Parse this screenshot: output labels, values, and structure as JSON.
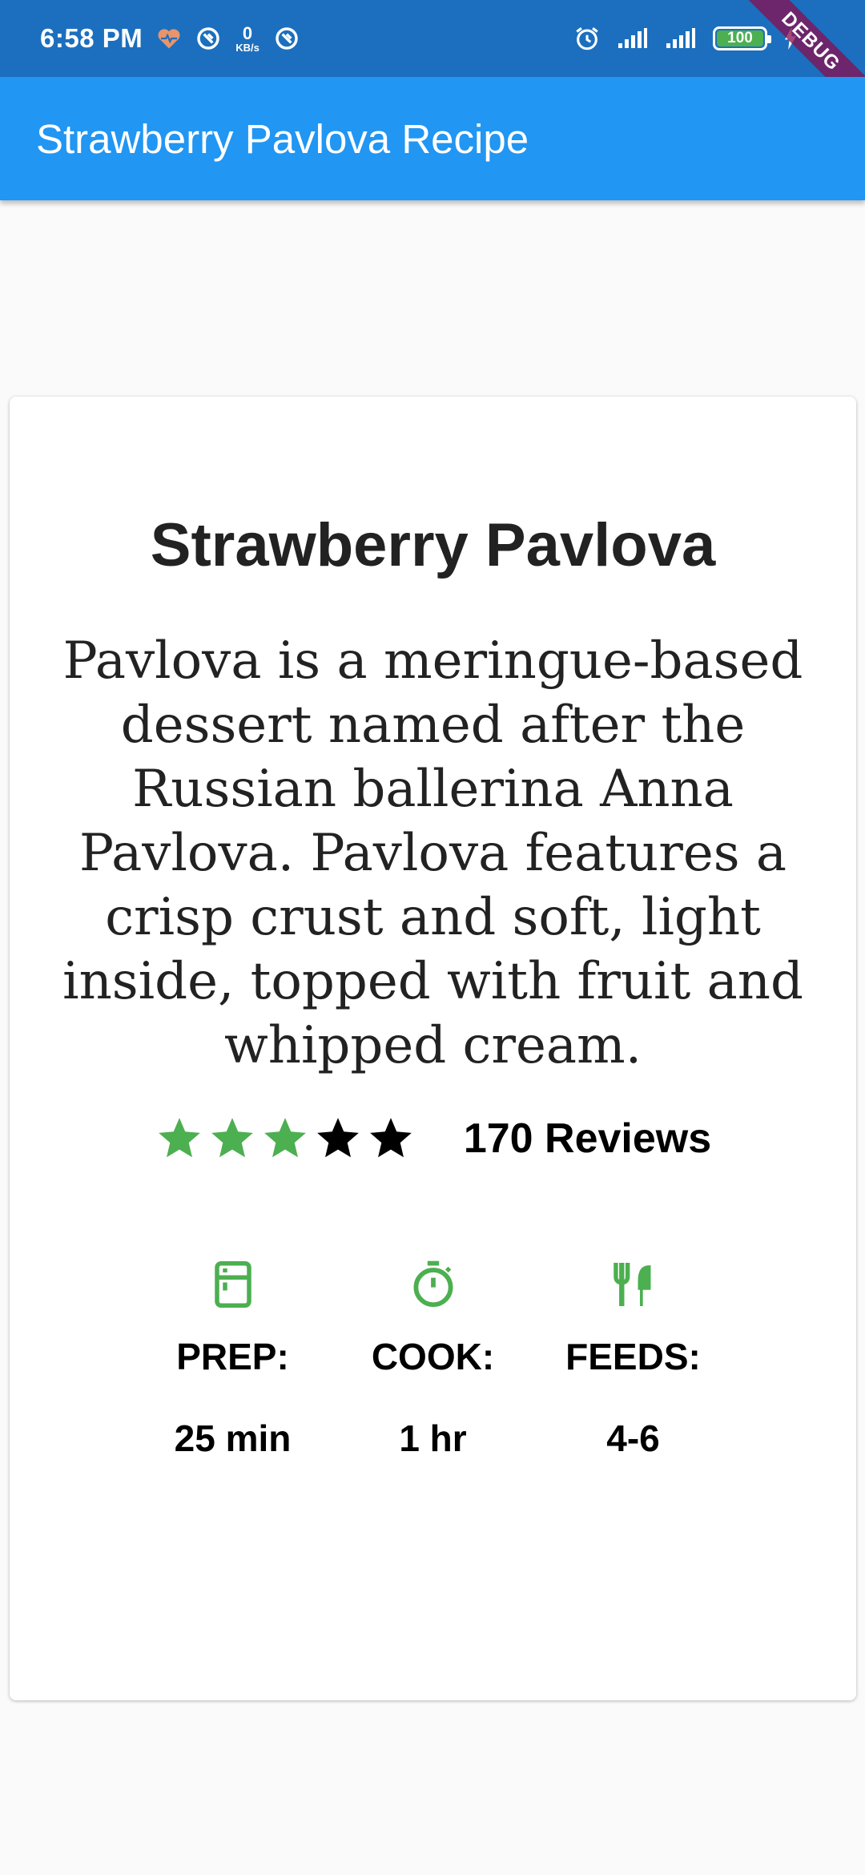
{
  "status_bar": {
    "time": "6:58 PM",
    "data_speed_value": "0",
    "data_speed_unit": "KB/s",
    "battery_level": "100"
  },
  "debug_banner": "DEBUG",
  "app_bar": {
    "title": "Strawberry Pavlova Recipe"
  },
  "recipe": {
    "title": "Strawberry Pavlova",
    "description": "Pavlova is a meringue-based dessert named after the Russian ballerina Anna Pavlova. Pavlova features a crisp crust and soft, light inside, topped with fruit and whipped cream.",
    "rating": {
      "stars_filled": 3,
      "stars_total": 5,
      "filled_color": "#4caf50",
      "empty_color": "#000000",
      "reviews_label": "170 Reviews"
    },
    "info": [
      {
        "icon": "kitchen-icon",
        "label": "PREP:",
        "value": "25 min"
      },
      {
        "icon": "timer-icon",
        "label": "COOK:",
        "value": "1 hr"
      },
      {
        "icon": "restaurant-icon",
        "label": "FEEDS:",
        "value": "4-6"
      }
    ],
    "accent_color": "#4caf50"
  }
}
